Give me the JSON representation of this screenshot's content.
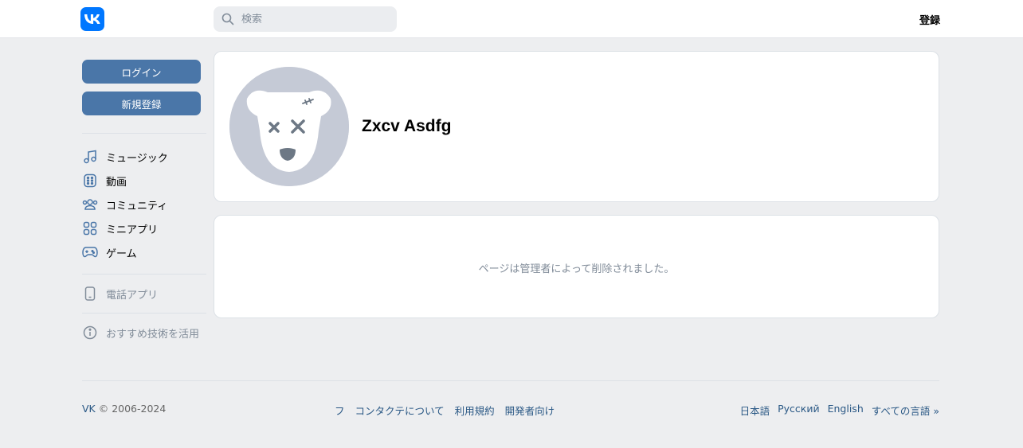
{
  "header": {
    "search_placeholder": "検索",
    "register_label": "登録"
  },
  "sidebar": {
    "login_label": "ログイン",
    "signup_label": "新規登録",
    "nav": [
      {
        "label": "ミュージック",
        "icon": "music-icon"
      },
      {
        "label": "動画",
        "icon": "video-icon"
      },
      {
        "label": "コミュニティ",
        "icon": "community-icon"
      },
      {
        "label": "ミニアプリ",
        "icon": "mini-apps-icon"
      },
      {
        "label": "ゲーム",
        "icon": "gamepad-icon"
      }
    ],
    "phone_app_label": "電話アプリ",
    "recommend_label": "おすすめ技術を活用"
  },
  "profile": {
    "name": "Zxcv Asdfg",
    "avatar": "deleted-dog-avatar"
  },
  "message": {
    "text": "ページは管理者によって削除されました。"
  },
  "footer": {
    "brand": "VK",
    "copyright": " © 2006-2024",
    "links": [
      "フ",
      "コンタクテについて",
      "利用規約",
      "開発者向け"
    ],
    "languages": [
      "日本語",
      "Русский",
      "English",
      "すべての言語 »"
    ]
  },
  "colors": {
    "accent": "#4a76a8",
    "logo": "#0077ff",
    "link": "#2a5885",
    "background": "#edeef0",
    "muted_text": "#818c99"
  }
}
